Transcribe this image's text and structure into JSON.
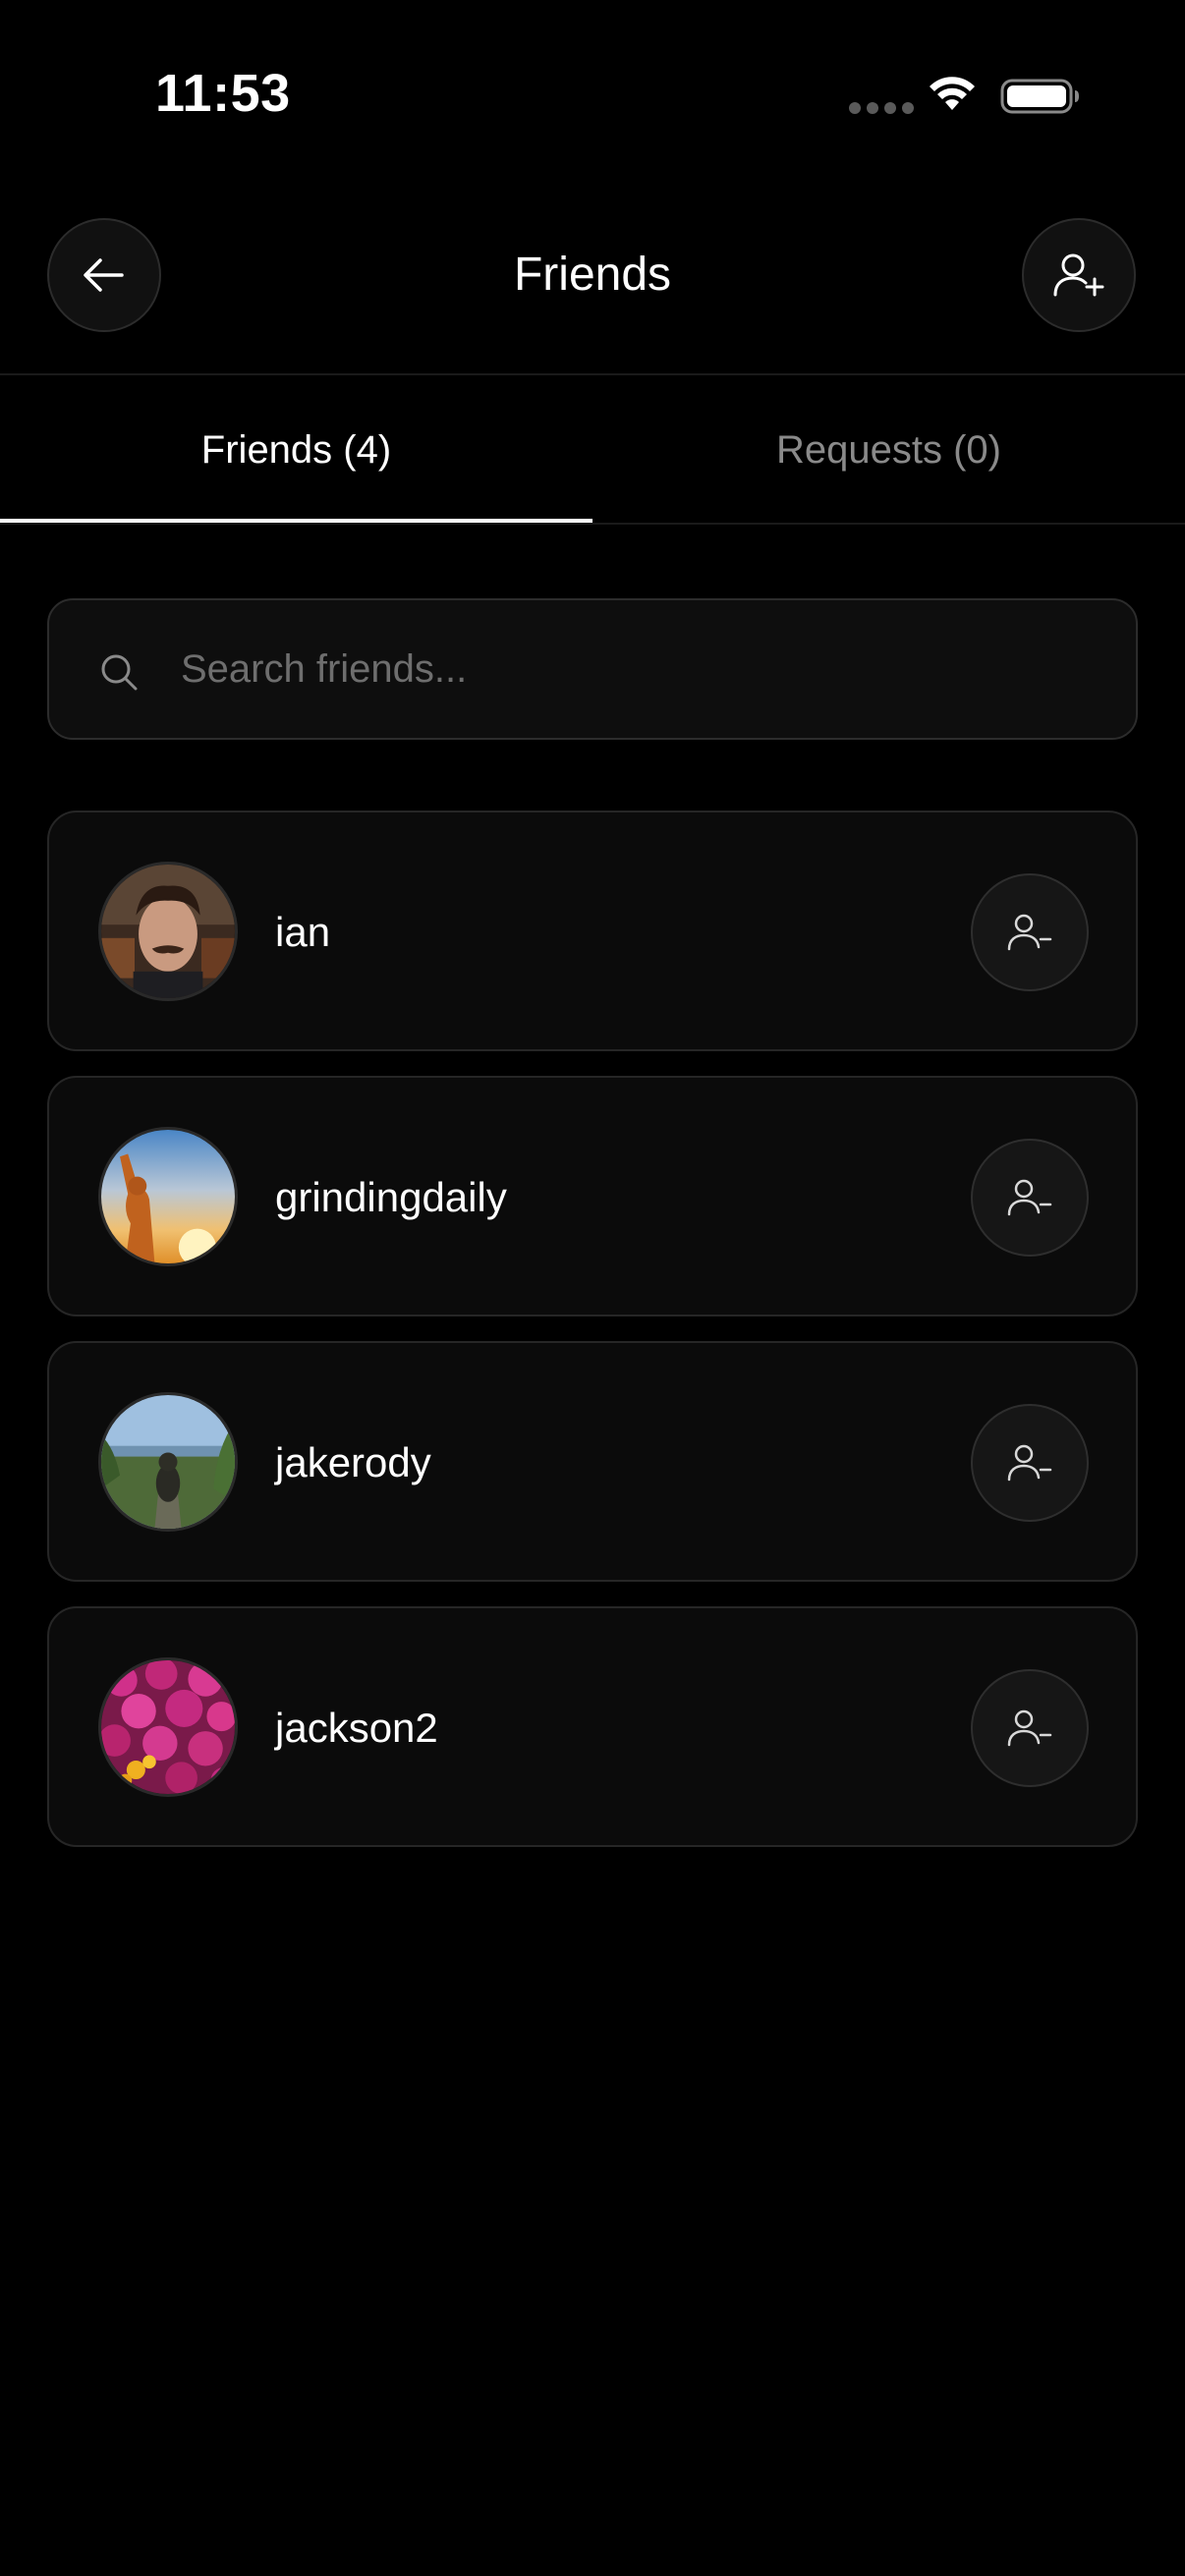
{
  "status_bar": {
    "time": "11:53"
  },
  "header": {
    "title": "Friends",
    "back_icon": "arrow-left-icon",
    "add_icon": "user-plus-icon"
  },
  "tabs": [
    {
      "label": "Friends (4)",
      "active": true
    },
    {
      "label": "Requests (0)",
      "active": false
    }
  ],
  "search": {
    "placeholder": "Search friends...",
    "value": ""
  },
  "friends": [
    {
      "name": "ian",
      "remove_icon": "user-minus-icon"
    },
    {
      "name": "grindingdaily",
      "remove_icon": "user-minus-icon"
    },
    {
      "name": "jakerody",
      "remove_icon": "user-minus-icon"
    },
    {
      "name": "jackson2",
      "remove_icon": "user-minus-icon"
    }
  ],
  "colors": {
    "background": "#000000",
    "card": "#0b0b0b",
    "border": "#262626",
    "muted_text": "#8a8a8a"
  }
}
